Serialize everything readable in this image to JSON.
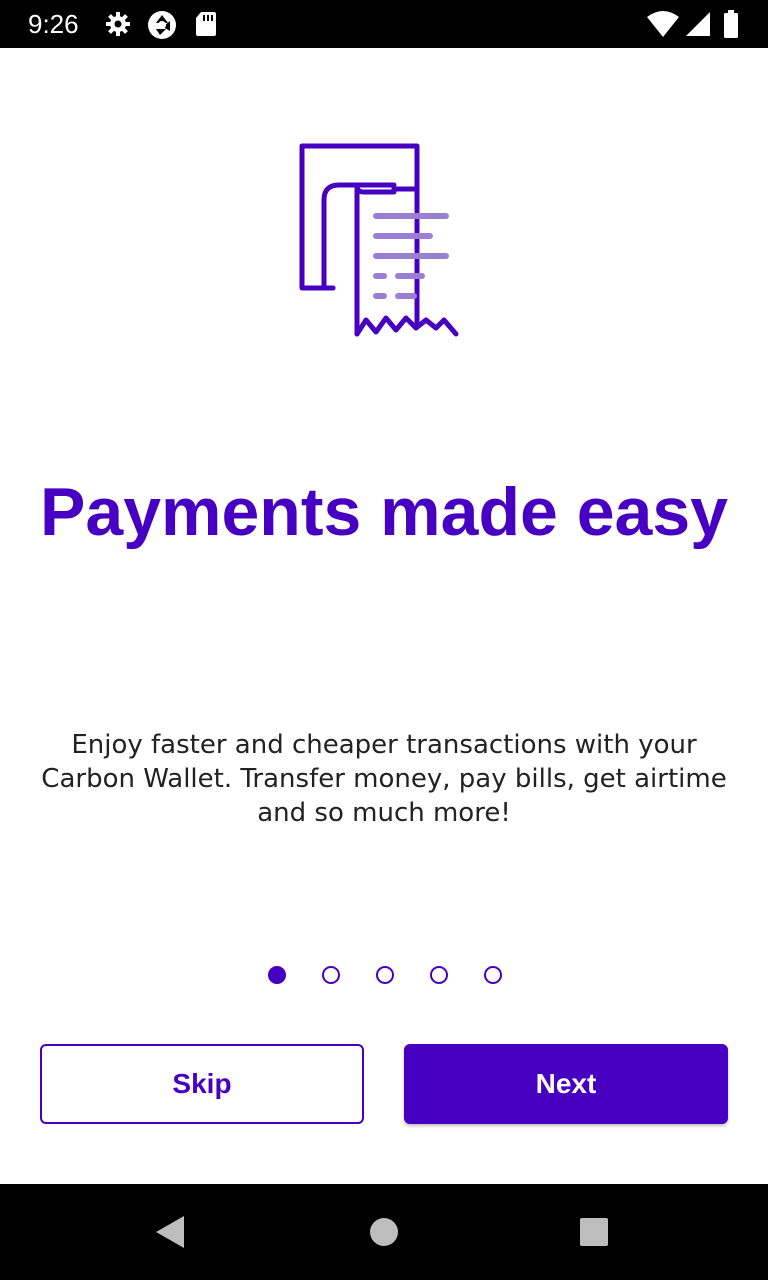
{
  "status_bar": {
    "time": "9:26",
    "icons": [
      "gear-icon",
      "shutter-icon",
      "sd-card-icon",
      "wifi-icon",
      "signal-icon",
      "battery-icon"
    ]
  },
  "illustration": {
    "icon": "receipt-icon",
    "colors": {
      "primary": "#4700c2",
      "secondary": "#9b7fd4"
    }
  },
  "onboarding": {
    "title": "Payments made easy",
    "description": "Enjoy faster and cheaper transactions with your Carbon Wallet. Transfer money, pay bills, get airtime and so much more!",
    "pages_total": 5,
    "current_page": 1
  },
  "buttons": {
    "skip_label": "Skip",
    "next_label": "Next"
  },
  "nav_bar": {
    "icons": [
      "back-icon",
      "home-icon",
      "recents-icon"
    ]
  },
  "colors": {
    "accent": "#4700c2",
    "background": "#ffffff",
    "system_bars": "#000000"
  }
}
